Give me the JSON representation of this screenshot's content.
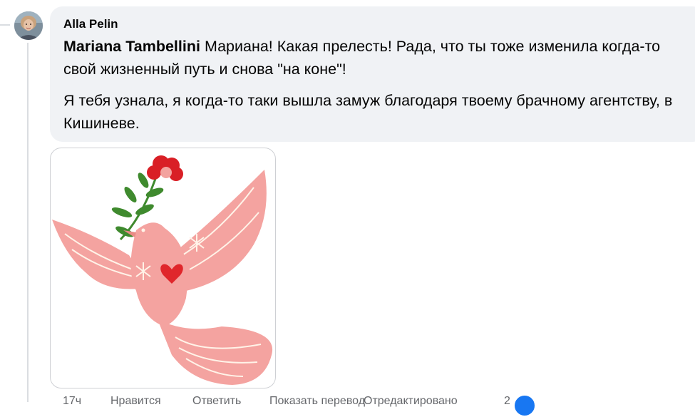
{
  "comment": {
    "author": "Alla Pelin",
    "mention": "Mariana Tambellini",
    "line1": " Мариана! Какая прелесть! Рада, что ты тоже изменила когда-то свой жизненный путь и снова \"на коне\"!",
    "paragraph2": "Я тебя узнала, я когда-то таки вышла замуж благодаря твоему брачному агентству, в Кишиневе.",
    "attachment_icon": "sticker-dove-with-flower",
    "colors": {
      "bubble": "#f0f2f5",
      "dove": "#f4a3a0",
      "heart": "#e0262b",
      "flower": "#d91f26",
      "leaf": "#3f8a2e"
    }
  },
  "actions": {
    "time": "17ч",
    "like": "Нравится",
    "reply": "Ответить",
    "translate": "Показать перевод",
    "edit": "Отредактировано",
    "reaction_count": "2"
  }
}
